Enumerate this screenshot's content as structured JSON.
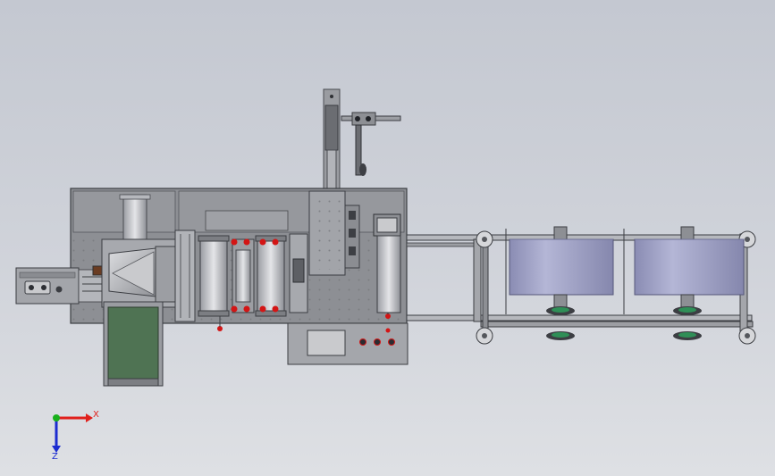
{
  "viewport": {
    "background_top": "#c4c8d1",
    "background_bottom": "#dee0e4"
  },
  "triad": {
    "x_label": "X",
    "z_label": "Z",
    "x_color": "#e0201c",
    "y_color": "#18b01c",
    "z_color": "#1c2cd0"
  },
  "colors": {
    "frame": "#8d8f94",
    "frame_dark": "#55575c",
    "conveyor": "#4f7353",
    "roll": "#a0a2c6",
    "roll_dark": "#7f81a6",
    "hub_green": "#2f8f57",
    "indicator_red": "#d31515"
  }
}
